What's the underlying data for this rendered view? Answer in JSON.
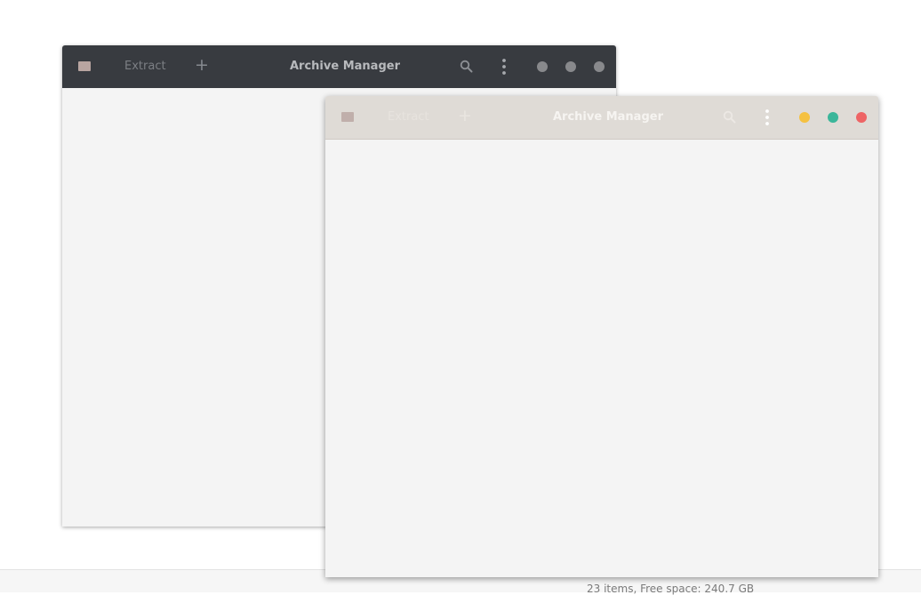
{
  "status_bar": {
    "text": "23 items, Free space: 240.7 GB"
  },
  "back_window": {
    "title": "Archive Manager",
    "extract_label": "Extract",
    "add_label": "+",
    "icons": [
      "archive-app-icon",
      "search-icon",
      "menu-icon",
      "minimize-icon",
      "maximize-icon",
      "close-icon"
    ],
    "header_color": "#383b40",
    "control_color": "#88898c"
  },
  "front_window": {
    "title": "Archive Manager",
    "extract_label": "Extract",
    "add_label": "+",
    "icons": [
      "archive-app-icon",
      "search-icon",
      "menu-icon",
      "minimize-icon",
      "maximize-icon",
      "close-icon"
    ],
    "header_color": "#dfdbd6",
    "control_colors": {
      "minimize": "#f5c141",
      "maximize": "#3bb69a",
      "close": "#ee6465"
    }
  }
}
